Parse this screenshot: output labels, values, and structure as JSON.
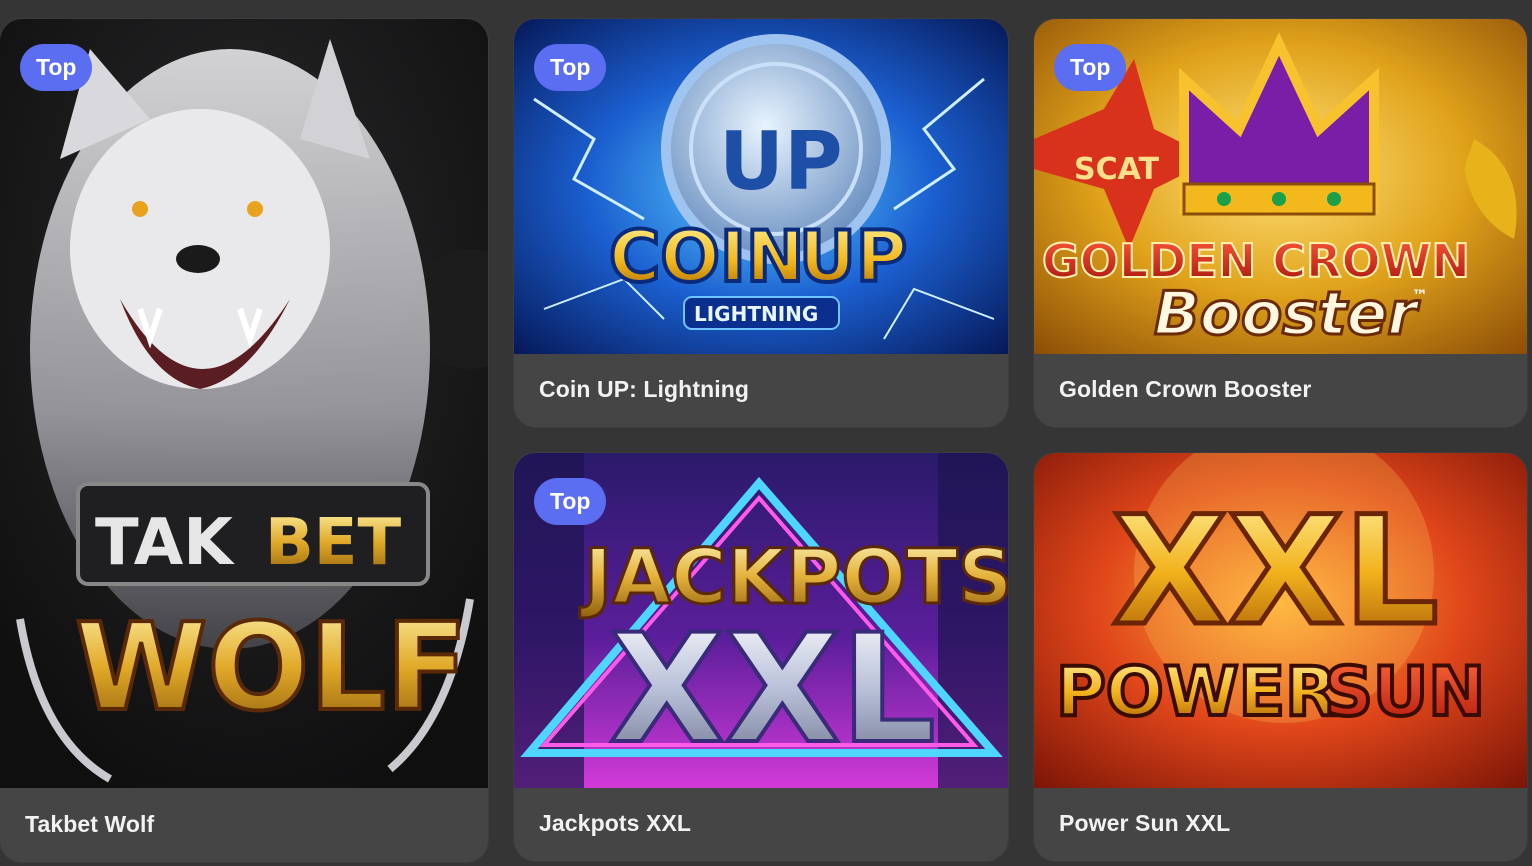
{
  "games": [
    {
      "name": "Takbet Wolf",
      "badge": "Top",
      "logo_line1a": "TAK",
      "logo_line1b": "BET",
      "logo_line2": "WOLF"
    },
    {
      "name": "Coin UP: Lightning",
      "badge": "Top",
      "logo_word1": "COIN",
      "logo_word2": "UP",
      "logo_sub": "LIGHTNING",
      "coin_text": "UP"
    },
    {
      "name": "Golden Crown Booster",
      "badge": "Top",
      "logo_line1": "GOLDEN CROWN",
      "logo_line2": "Booster",
      "logo_tm": "™",
      "scat": "SCAT"
    },
    {
      "name": "Jackpots XXL",
      "badge": "Top",
      "logo_line1": "JACKPOTS",
      "logo_line2": "XXL"
    },
    {
      "name": "Power Sun XXL",
      "logo_line1": "XXL",
      "logo_line2a": "POWER",
      "logo_line2b": "SUN"
    }
  ],
  "colors": {
    "badge": "#5b6df0",
    "card": "#454545",
    "page": "#353535"
  }
}
